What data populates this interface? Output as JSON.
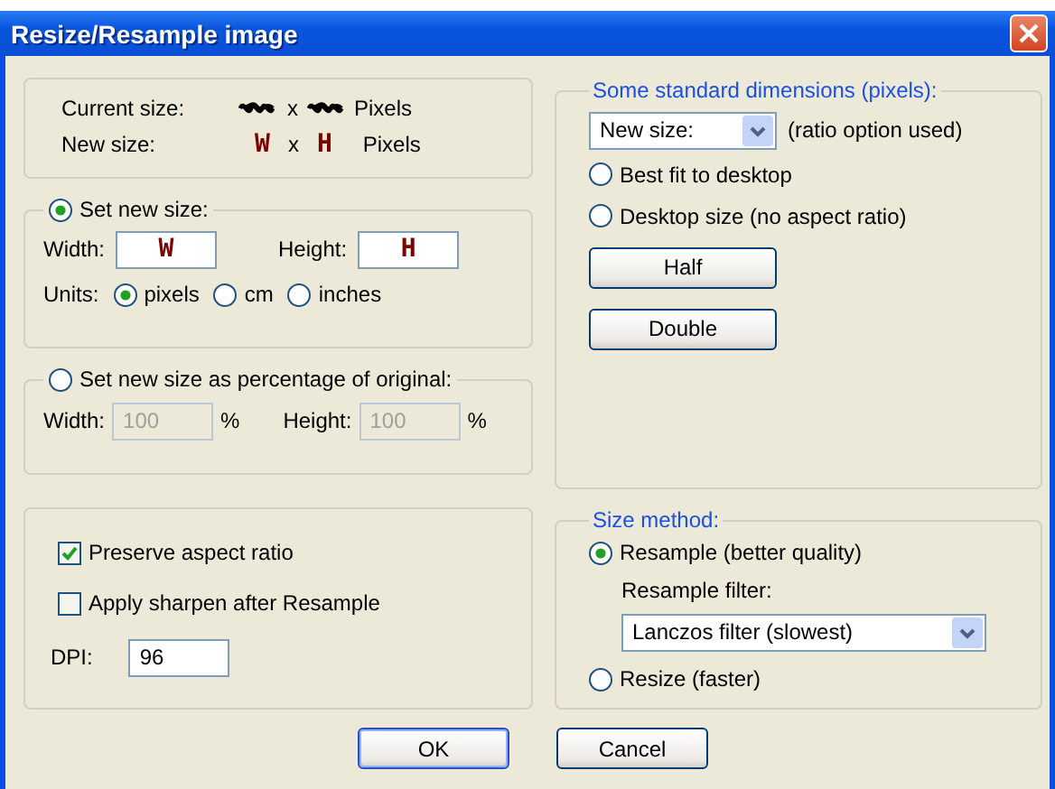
{
  "window": {
    "title": "Resize/Resample image"
  },
  "info": {
    "current_label": "Current size:",
    "current_separator": "x",
    "current_unit": "Pixels",
    "new_label": "New size:",
    "new_width": "W",
    "new_separator": "x",
    "new_height": "H",
    "new_unit": "Pixels"
  },
  "set_size": {
    "label": "Set new size:",
    "selected": true,
    "width_label": "Width:",
    "width_value": "W",
    "height_label": "Height:",
    "height_value": "H",
    "units_label": "Units:",
    "units": [
      {
        "label": "pixels",
        "selected": true
      },
      {
        "label": "cm",
        "selected": false
      },
      {
        "label": "inches",
        "selected": false
      }
    ]
  },
  "percentage": {
    "label": "Set new size as percentage of original:",
    "selected": false,
    "disabled": true,
    "width_label": "Width:",
    "width_value": "100",
    "width_unit": "%",
    "height_label": "Height:",
    "height_value": "100",
    "height_unit": "%"
  },
  "options": {
    "checkboxes": [
      {
        "label": "Preserve aspect ratio",
        "checked": true
      },
      {
        "label": "Apply sharpen after Resample",
        "checked": false
      }
    ],
    "dpi_label": "DPI:",
    "dpi_value": "96"
  },
  "standard": {
    "title": "Some standard dimensions (pixels):",
    "dropdown_value": "New size:",
    "dropdown_note": "(ratio option used)",
    "radios": [
      {
        "label": "Best fit to desktop",
        "selected": false
      },
      {
        "label": "Desktop size (no aspect ratio)",
        "selected": false
      }
    ],
    "buttons": [
      "Half",
      "Double"
    ]
  },
  "method": {
    "title": "Size method:",
    "resample": {
      "label": "Resample (better quality)",
      "selected": true
    },
    "filter_label": "Resample filter:",
    "filter_value": "Lanczos filter (slowest)",
    "resize": {
      "label": "Resize (faster)",
      "selected": false
    }
  },
  "buttons": [
    {
      "label": "OK",
      "default": true
    },
    {
      "label": "Cancel",
      "default": false
    }
  ]
}
